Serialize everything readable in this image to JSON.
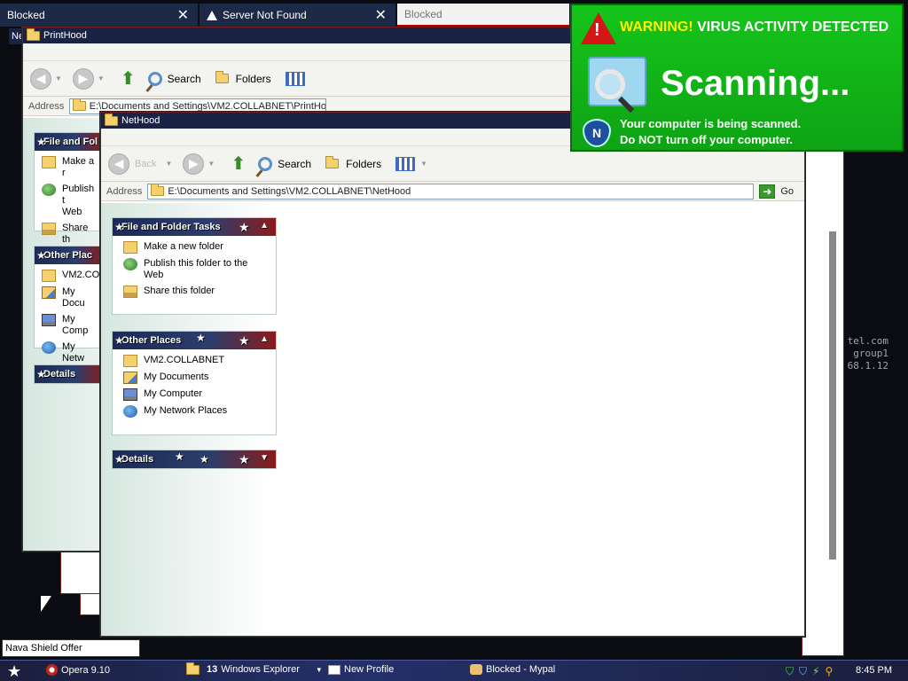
{
  "browser_tabs": [
    {
      "title": "Blocked",
      "has_close": true
    },
    {
      "title": "Server Not Found",
      "has_close": true
    },
    {
      "title": "Blocked",
      "has_close": false
    }
  ],
  "windows": {
    "back": {
      "title": "PrintHood",
      "address_label": "Address",
      "address_value": "E:\\Documents and Settings\\VM2.COLLABNET\\PrintHood",
      "panels": {
        "file_tasks_title": "File and Fol",
        "file_tasks": [
          "Make a r",
          "Publish t",
          "Web",
          "Share th"
        ],
        "other_places_title": "Other Plac",
        "other_places": [
          "VM2.CO",
          "My Docu",
          "My Comp",
          "My Netw"
        ],
        "details_title": "Details"
      },
      "small_tab_label": "Ne"
    },
    "front": {
      "title": "NetHood",
      "toolbar": {
        "back_label": "Back",
        "search_label": "Search",
        "folders_label": "Folders"
      },
      "address_label": "Address",
      "address_value": "E:\\Documents and Settings\\VM2.COLLABNET\\NetHood",
      "go_label": "Go",
      "panels": {
        "file_tasks_title": "File and Folder Tasks",
        "file_tasks": [
          {
            "label": "Make a new folder",
            "icon": "new-folder-icon"
          },
          {
            "label": "Publish this folder to the Web",
            "icon": "globe-icon"
          },
          {
            "label": "Share this folder",
            "icon": "share-folder-icon"
          }
        ],
        "other_places_title": "Other Places",
        "other_places": [
          {
            "label": "VM2.COLLABNET",
            "icon": "folder-icon"
          },
          {
            "label": "My Documents",
            "icon": "my-documents-icon"
          },
          {
            "label": "My Computer",
            "icon": "my-computer-icon"
          },
          {
            "label": "My Network Places",
            "icon": "network-places-icon"
          }
        ],
        "details_title": "Details"
      }
    }
  },
  "side_text": [
    "tel.com",
    "group1",
    "68.1.12"
  ],
  "popup": {
    "warning_word": "WARNING!",
    "warning_rest": "VIRUS ACTIVITY DETECTED",
    "status": "Scanning...",
    "line1": "Your computer is being scanned.",
    "line2_pre": "Do ",
    "line2_strong": "NOT",
    "line2_post": " turn off your computer.",
    "shield_letter": "N",
    "colors": {
      "background": "#12b517",
      "warning_yellow": "#ffee00",
      "warning_red": "#d41616"
    }
  },
  "tooltip": "Nava Shield Offer",
  "taskbar": {
    "items": [
      {
        "label": "Opera 9.10",
        "icon": "opera-icon"
      },
      {
        "count": "13",
        "label": "Windows Explorer",
        "icon": "folder-icon"
      },
      {
        "label": "New Profile",
        "icon": "window-icon"
      },
      {
        "label": "Blocked - Mypal",
        "icon": "mypal-icon"
      }
    ],
    "time": "8:45 PM"
  }
}
